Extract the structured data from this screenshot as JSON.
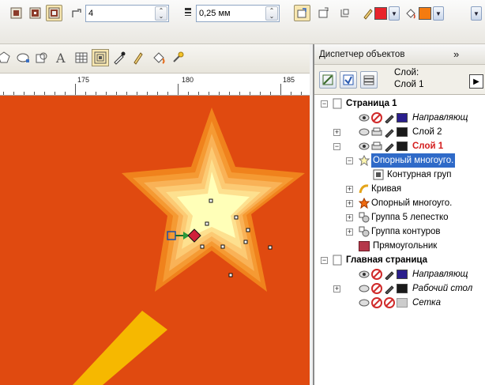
{
  "propbar": {
    "corner_value": "4",
    "outline_value": "0,25 мм",
    "outline_color": "#e8232a",
    "fill_color": "#f47b10"
  },
  "ruler": {
    "labels": [
      "175",
      "180",
      "185"
    ]
  },
  "docker": {
    "title": "Диспетчер объектов",
    "more": "»",
    "layer_caption": "Слой:",
    "layer_value": "Слой 1"
  },
  "tree": [
    {
      "label": "Страница 1",
      "bold": true
    },
    {
      "label": "Направляющ",
      "italic": true,
      "color": "#2a1e8c"
    },
    {
      "label": "Слой 2",
      "color": "#1a1a1a"
    },
    {
      "label": "Слой 1",
      "bold": true,
      "red": true,
      "color": "#1a1a1a"
    },
    {
      "label": "Опорный многоуго.",
      "selected": true
    },
    {
      "label": "Контурная груп"
    },
    {
      "label": "Кривая"
    },
    {
      "label": "Опорный многоуго."
    },
    {
      "label": "Группа 5 лепестко"
    },
    {
      "label": "Группа контуров"
    },
    {
      "label": "Прямоугольник",
      "color": "#b5384a"
    },
    {
      "label": "Главная страница",
      "bold": true
    },
    {
      "label": "Направляющ",
      "italic": true,
      "color": "#2a1e8c"
    },
    {
      "label": "Рабочий стол",
      "italic": true,
      "color": "#1a1a1a"
    },
    {
      "label": "Сетка",
      "italic": true,
      "color": "#cccccc"
    }
  ],
  "canvas": {
    "background": "#e04a10",
    "star_outer": "#f0821c",
    "star_mid": "#f9b257",
    "star_inner": "#fde08f",
    "star_core": "#ffffb8",
    "bar_color": "#f6b800"
  }
}
